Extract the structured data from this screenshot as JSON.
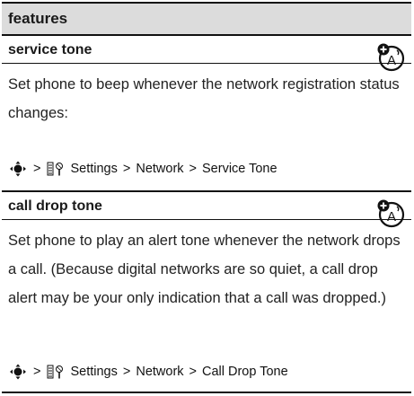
{
  "header": {
    "title": "features"
  },
  "sections": [
    {
      "title": "service tone",
      "description": "Set phone to beep whenever the network registration status changes:",
      "path": {
        "settings": "Settings",
        "network": "Network",
        "item": "Service Tone"
      },
      "badge_icon": "network-dependent-feature-icon"
    },
    {
      "title": "call drop tone",
      "description": "Set phone to play an alert tone whenever the network drops a call. (Because digital networks are so quiet, a call drop alert may be your only indication that a call was dropped.)",
      "path": {
        "settings": "Settings",
        "network": "Network",
        "item": "Call Drop Tone"
      },
      "badge_icon": "network-dependent-feature-icon"
    }
  ],
  "symbols": {
    "arrow": ">"
  }
}
